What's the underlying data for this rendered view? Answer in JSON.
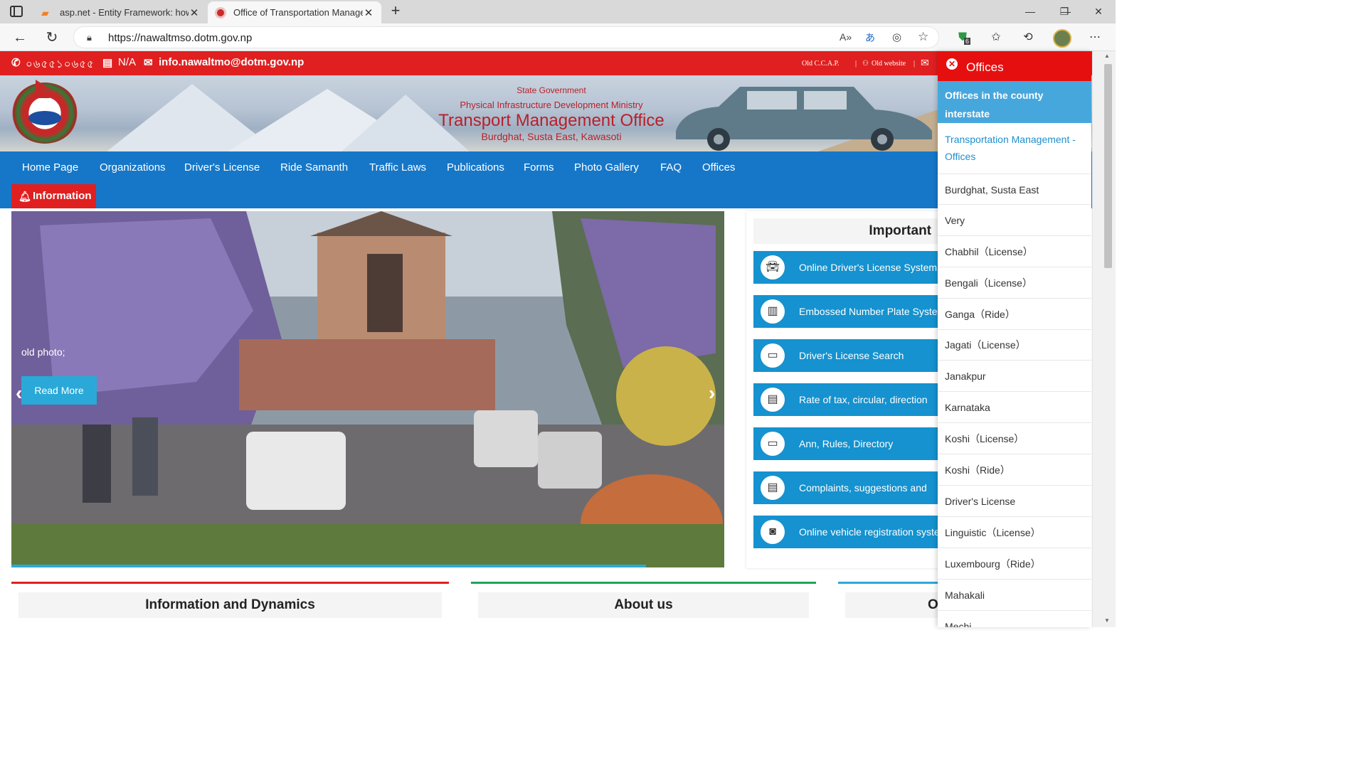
{
  "browser": {
    "tabs": [
      {
        "title": "asp.net - Entity Framework: how"
      },
      {
        "title": "Office of Transportation Manage"
      }
    ],
    "url": "https://nawaltmso.dotm.gov.np",
    "extension_badge": "6"
  },
  "topbar": {
    "phone": "০৬৫৫১০৬৫৫",
    "fax": "N/A",
    "email": "info.nawaltmo@dotm.gov.np",
    "links": [
      "Old C.C.A.P.",
      "Old website"
    ]
  },
  "header": {
    "line1": "State Government",
    "line2": "Physical Infrastructure Development Ministry",
    "title": "Transport Management Office",
    "address": "Burdghat, Susta East, Kawasoti"
  },
  "nav": [
    "Home Page",
    "Organizations",
    "Driver's License",
    "Ride Samanth",
    "Traffic Laws",
    "Publications",
    "Forms",
    "Photo Gallery",
    "FAQ",
    "Offices"
  ],
  "info_label": "Information",
  "slider": {
    "caption": "old photo;",
    "read_more": "Read More",
    "progress": 0.89
  },
  "important": {
    "title": "Important",
    "items": [
      {
        "label": "Online Driver's License System",
        "icon": "car-icon"
      },
      {
        "label": "Embossed Number Plate System",
        "icon": "barcode-icon"
      },
      {
        "label": "Driver's License Search",
        "icon": "card-icon"
      },
      {
        "label": "Rate of tax, circular, direction",
        "icon": "newspaper-icon"
      },
      {
        "label": "Ann, Rules, Directory",
        "icon": "card-icon"
      },
      {
        "label": "Complaints, suggestions and",
        "icon": "newspaper-icon"
      },
      {
        "label": "Online vehicle registration system",
        "icon": "id-badge-icon"
      }
    ]
  },
  "bottom_cards": [
    "Information and Dynamics",
    "About us",
    "O"
  ],
  "offices_panel": {
    "title": "Offices",
    "subtitle": "Offices in the county interstate",
    "link": "Transportation Management - Offices",
    "items": [
      "Burdghat, Susta East",
      "Very",
      "Chabhil（License）",
      "Bengali（License）",
      "Ganga（Ride）",
      "Jagati（License）",
      "Janakpur",
      "Karnataka",
      "Koshi（License）",
      "Koshi（Ride）",
      "Driver's License",
      "Linguistic（License）",
      "Luxembourg（Ride）",
      "Mahakali",
      "Mechi"
    ]
  },
  "colors": {
    "red": "#e02020",
    "blue": "#1677c8",
    "light_blue": "#46a7dd",
    "item_blue": "#1592cf"
  }
}
